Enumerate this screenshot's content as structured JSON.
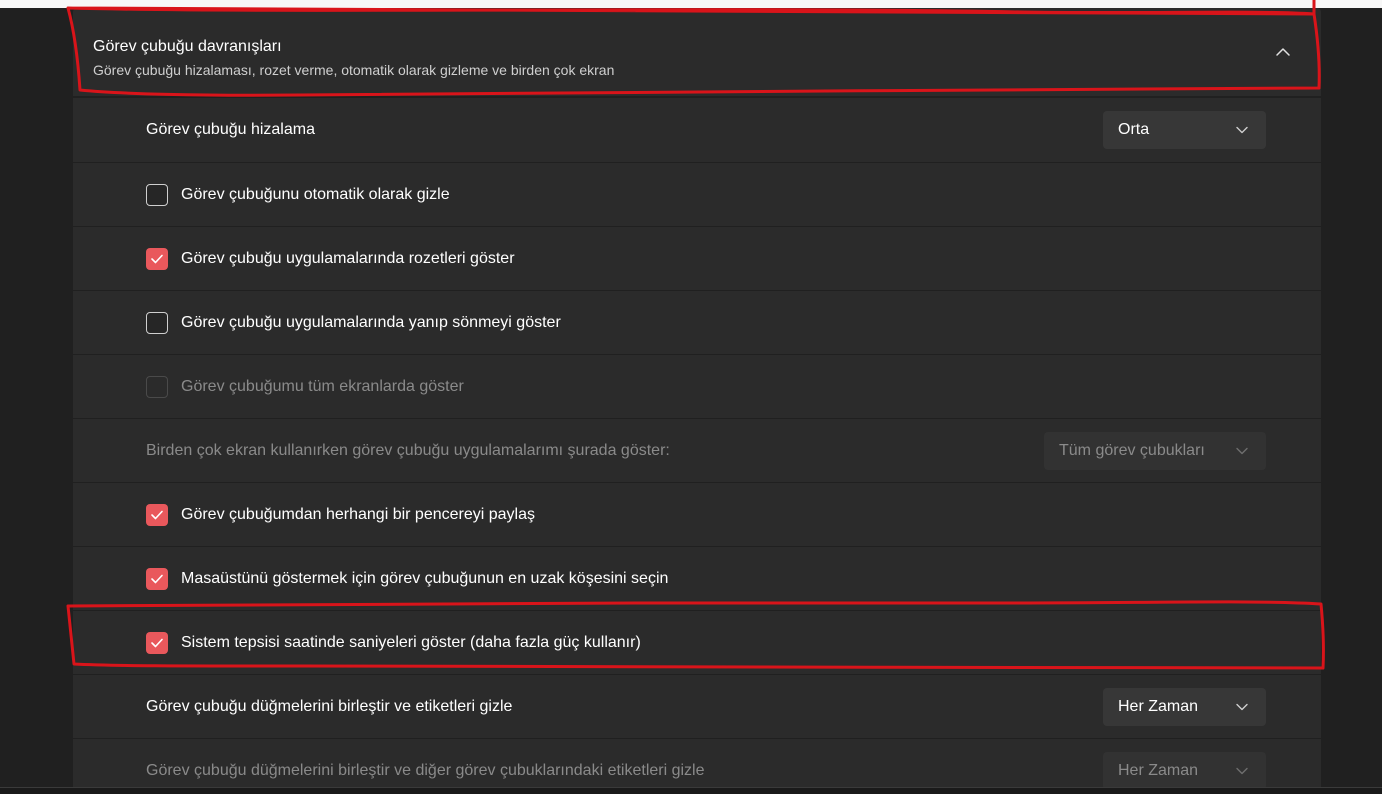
{
  "header": {
    "title": "Görev çubuğu davranışları",
    "subtitle": "Görev çubuğu hizalaması, rozet verme, otomatik olarak gizleme ve birden çok ekran"
  },
  "rows": [
    {
      "label": "Görev çubuğu hizalama",
      "dropdown": "Orta"
    },
    {
      "label": "Görev çubuğunu otomatik olarak gizle",
      "checked": false
    },
    {
      "label": "Görev çubuğu uygulamalarında rozetleri göster",
      "checked": true
    },
    {
      "label": "Görev çubuğu uygulamalarında yanıp sönmeyi göster",
      "checked": false
    },
    {
      "label": "Görev çubuğumu tüm ekranlarda göster",
      "checked": false,
      "disabled": true
    },
    {
      "label": "Birden çok ekran kullanırken görev çubuğu uygulamalarımı şurada göster:",
      "dropdown": "Tüm görev çubukları",
      "disabled": true
    },
    {
      "label": "Görev çubuğumdan herhangi bir pencereyi paylaş",
      "checked": true
    },
    {
      "label": "Masaüstünü göstermek için görev çubuğunun en uzak köşesini seçin",
      "checked": true
    },
    {
      "label": "Sistem tepsisi saatinde saniyeleri göster (daha fazla güç kullanır)",
      "checked": true
    },
    {
      "label": "Görev çubuğu düğmelerini birleştir ve etiketleri gizle",
      "dropdown": "Her Zaman"
    },
    {
      "label": "Görev çubuğu düğmelerini birleştir ve diğer görev çubuklarındaki etiketleri gizle",
      "dropdown": "Her Zaman",
      "disabled": true
    }
  ],
  "colors": {
    "accent": "#e9585c",
    "annotation": "#d9141a",
    "background": "#202020",
    "card": "#2b2b2b"
  }
}
